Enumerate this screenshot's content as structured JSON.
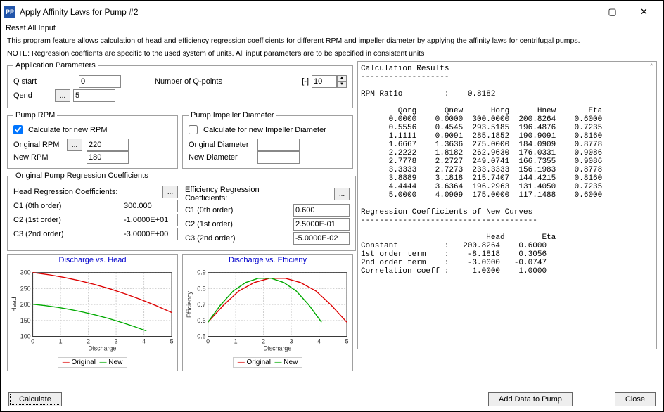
{
  "window": {
    "title": "Apply Affinity Laws for Pump #2"
  },
  "menu": {
    "reset": "Reset All Input"
  },
  "intro1": "This program feature allows calculation of head and efficiency regression coefficients for different RPM and impeller diameter by applying the affinity laws for centrifugal pumps.",
  "intro2": "NOTE: Regression coeffients are specific to the used system of units. All input parameters are to be specified in consistent units",
  "appParams": {
    "legend": "Application Parameters",
    "qstart_lbl": "Q start",
    "qstart_val": "0",
    "qend_lbl": "Qend",
    "qend_val": "5",
    "npoints_lbl": "Number of Q-points",
    "npoints_unit": "[-]",
    "npoints_val": "10"
  },
  "rpm": {
    "legend": "Pump RPM",
    "calc_lbl": "Calculate for new RPM",
    "calc_checked": true,
    "orig_lbl": "Original RPM",
    "orig_val": "220",
    "new_lbl": "New RPM",
    "new_val": "180"
  },
  "dia": {
    "legend": "Pump Impeller Diameter",
    "calc_lbl": "Calculate for new Impeller Diameter",
    "calc_checked": false,
    "orig_lbl": "Original Diameter",
    "orig_val": "",
    "new_lbl": "New Diameter",
    "new_val": ""
  },
  "coef": {
    "legend": "Original Pump Regression Coefficients",
    "head_lbl": "Head Regression Coefficients:",
    "eff_lbl": "Efficiency Regression Coefficients:",
    "c1_lbl": "C1 (0th order)",
    "c2_lbl": "C2 (1st order)",
    "c3_lbl": "C3 (2nd order)",
    "head": {
      "c1": "300.000",
      "c2": "-1.0000E+01",
      "c3": "-3.0000E+00"
    },
    "eff": {
      "c1": "0.600",
      "c2": "2.5000E-01",
      "c3": "-5.0000E-02"
    }
  },
  "buttons": {
    "calc": "Calculate",
    "add": "Add Data to Pump",
    "close": "Close",
    "ellipsis": "..."
  },
  "charts": {
    "head_title": "Discharge vs. Head",
    "eff_title": "Discharge vs. Efficieny",
    "xlabel": "Discharge",
    "head_ylabel": "Head",
    "eff_ylabel": "Efficiency",
    "legend_original": "Original",
    "legend_new": "New"
  },
  "results_title": "Calculation Results",
  "results": {
    "rpm_ratio_lbl": "RPM Ratio",
    "rpm_ratio": "0.8182",
    "headers": [
      "Qorg",
      "Qnew",
      "Horg",
      "Hnew",
      "Eta"
    ],
    "rows": [
      [
        "0.0000",
        "0.0000",
        "300.0000",
        "200.8264",
        "0.6000"
      ],
      [
        "0.5556",
        "0.4545",
        "293.5185",
        "196.4876",
        "0.7235"
      ],
      [
        "1.1111",
        "0.9091",
        "285.1852",
        "190.9091",
        "0.8160"
      ],
      [
        "1.6667",
        "1.3636",
        "275.0000",
        "184.0909",
        "0.8778"
      ],
      [
        "2.2222",
        "1.8182",
        "262.9630",
        "176.0331",
        "0.9086"
      ],
      [
        "2.7778",
        "2.2727",
        "249.0741",
        "166.7355",
        "0.9086"
      ],
      [
        "3.3333",
        "2.7273",
        "233.3333",
        "156.1983",
        "0.8778"
      ],
      [
        "3.8889",
        "3.1818",
        "215.7407",
        "144.4215",
        "0.8160"
      ],
      [
        "4.4444",
        "3.6364",
        "196.2963",
        "131.4050",
        "0.7235"
      ],
      [
        "5.0000",
        "4.0909",
        "175.0000",
        "117.1488",
        "0.6000"
      ]
    ],
    "reg_title": "Regression Coefficients of New Curves",
    "reg_headers": [
      "Head",
      "Eta"
    ],
    "reg_rows": [
      [
        "Constant",
        "200.8264",
        "0.6000"
      ],
      [
        "1st order term",
        "-8.1818",
        "0.3056"
      ],
      [
        "2nd order term",
        "-3.0000",
        "-0.0747"
      ],
      [
        "Correlation coeff",
        "1.0000",
        "1.0000"
      ]
    ]
  },
  "chart_data": [
    {
      "type": "line",
      "title": "Discharge vs. Head",
      "xlabel": "Discharge",
      "ylabel": "Head",
      "xlim": [
        0,
        5
      ],
      "ylim": [
        100,
        300
      ],
      "series": [
        {
          "name": "Original",
          "color": "#d00",
          "x": [
            0,
            0.56,
            1.11,
            1.67,
            2.22,
            2.78,
            3.33,
            3.89,
            4.44,
            5.0
          ],
          "y": [
            300,
            293.5,
            285.2,
            275.0,
            263.0,
            249.1,
            233.3,
            215.7,
            196.3,
            175.0
          ]
        },
        {
          "name": "New",
          "color": "#0a0",
          "x": [
            0,
            0.45,
            0.91,
            1.36,
            1.82,
            2.27,
            2.73,
            3.18,
            3.64,
            4.09
          ],
          "y": [
            200.8,
            196.5,
            190.9,
            184.1,
            176.0,
            166.7,
            156.2,
            144.4,
            131.4,
            117.1
          ]
        }
      ]
    },
    {
      "type": "line",
      "title": "Discharge vs. Efficieny",
      "xlabel": "Discharge",
      "ylabel": "Efficiency",
      "xlim": [
        0,
        5
      ],
      "ylim": [
        0.5,
        0.95
      ],
      "series": [
        {
          "name": "Original",
          "color": "#d00",
          "x": [
            0,
            0.56,
            1.11,
            1.67,
            2.22,
            2.78,
            3.33,
            3.89,
            4.44,
            5.0
          ],
          "y": [
            0.6,
            0.72,
            0.82,
            0.88,
            0.91,
            0.91,
            0.88,
            0.82,
            0.72,
            0.6
          ]
        },
        {
          "name": "New",
          "color": "#0a0",
          "x": [
            0,
            0.45,
            0.91,
            1.36,
            1.82,
            2.27,
            2.73,
            3.18,
            3.64,
            4.09
          ],
          "y": [
            0.6,
            0.72,
            0.82,
            0.88,
            0.91,
            0.91,
            0.88,
            0.82,
            0.72,
            0.6
          ]
        }
      ]
    }
  ]
}
